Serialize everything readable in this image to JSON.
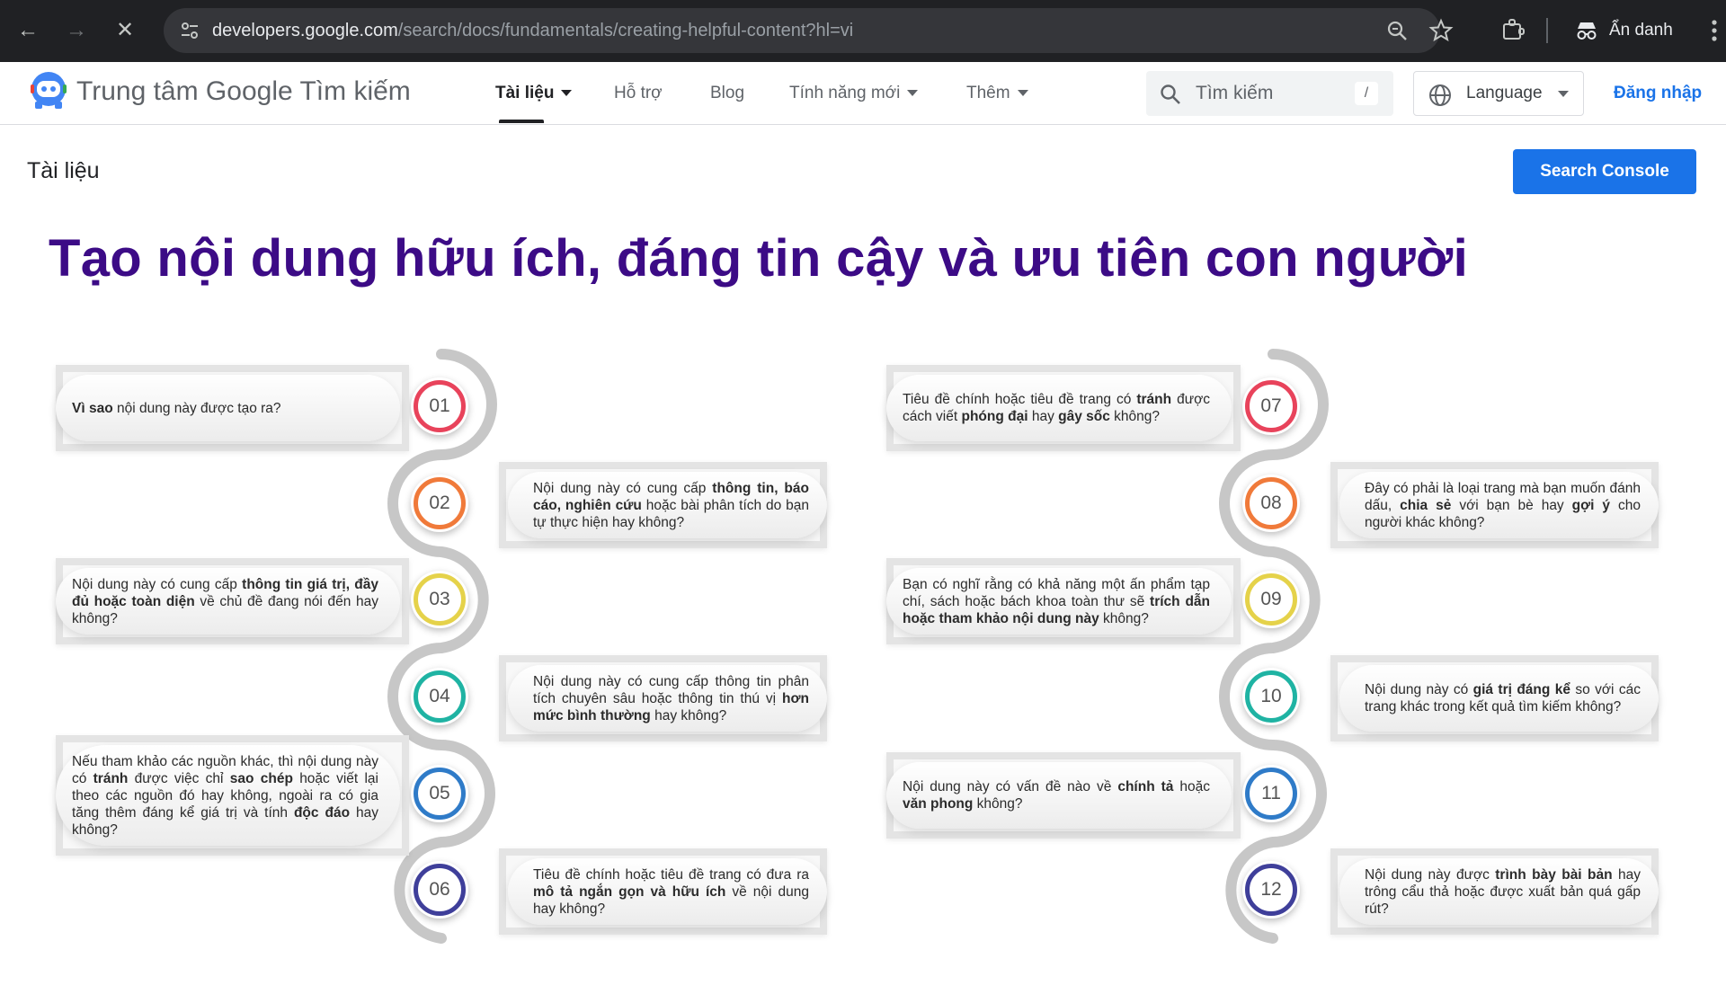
{
  "browser": {
    "url_host": "developers.google.com",
    "url_path": "/search/docs/fundamentals/creating-helpful-content?hl=vi",
    "incognito_label": "Ẩn danh"
  },
  "header": {
    "site_title": "Trung tâm Google Tìm kiếm",
    "nav": [
      {
        "label": "Tài liệu"
      },
      {
        "label": "Hỗ trợ"
      },
      {
        "label": "Blog"
      },
      {
        "label": "Tính năng mới"
      },
      {
        "label": "Thêm"
      }
    ],
    "search_placeholder": "Tìm kiếm",
    "search_shortcut": "/",
    "language_label": "Language",
    "signin_label": "Đăng nhập"
  },
  "subheader": {
    "breadcrumb": "Tài liệu",
    "search_console_label": "Search Console"
  },
  "page_title": "Tạo nội dung hữu ích, đáng tin cậy và ưu tiên con người",
  "infographic": {
    "items": [
      {
        "num": "01",
        "color": "#e8435b",
        "html": "<b>Vì sao</b> nội dung này được tạo ra?"
      },
      {
        "num": "02",
        "color": "#f07a3a",
        "html": "Nội dung này có cung cấp <b>thông tin, báo cáo, nghiên cứu</b> hoặc bài phân tích do bạn tự thực hiện hay không?"
      },
      {
        "num": "03",
        "color": "#e5d24a",
        "html": "Nội dung này có cung cấp <b>thông tin giá trị, đầy đủ hoặc toàn diện</b> về chủ đề đang nói đến hay không?"
      },
      {
        "num": "04",
        "color": "#1fb3a3",
        "html": "Nội dung này có cung cấp thông tin phân tích chuyên sâu hoặc thông tin thú vị <b>hơn mức bình thường</b> hay không?"
      },
      {
        "num": "05",
        "color": "#2f7bc8",
        "html": "Nếu tham khảo các nguồn khác, thì nội dung này có <b>tránh</b> được việc chỉ <b>sao chép</b> hoặc viết lại theo các nguồn đó hay không, ngoài ra có gia tăng thêm đáng kể giá trị và tính <b>độc đáo</b> hay không?"
      },
      {
        "num": "06",
        "color": "#3f3f9a",
        "html": "Tiêu đề chính hoặc tiêu đề trang có đưa ra <b>mô tả ngắn gọn và hữu ích</b> về nội dung hay không?"
      },
      {
        "num": "07",
        "color": "#e8435b",
        "html": "Tiêu đề chính hoặc tiêu đề trang có <b>tránh</b> được cách viết <b>phóng đại</b> hay <b>gây sốc</b> không?"
      },
      {
        "num": "08",
        "color": "#f07a3a",
        "html": "Đây có phải là loại trang mà bạn muốn đánh dấu, <b>chia sẻ</b> với bạn bè hay <b>gợi ý</b> cho người khác không?"
      },
      {
        "num": "09",
        "color": "#e5d24a",
        "html": "Bạn có nghĩ rằng có khả năng một ấn phẩm tạp chí, sách hoặc bách khoa toàn thư sẽ <b>trích dẫn hoặc tham khảo nội dung này</b> không?"
      },
      {
        "num": "10",
        "color": "#1fb3a3",
        "html": "Nội dung này có <b>giá trị đáng kể</b> so với các trang khác trong kết quả tìm kiếm không?"
      },
      {
        "num": "11",
        "color": "#2f7bc8",
        "html": "Nội dung này có vấn đề nào về <b>chính tả</b> hoặc <b>văn phong</b> không?"
      },
      {
        "num": "12",
        "color": "#3f3f9a",
        "html": "Nội dung này được <b>trình bày bài bản</b> hay trông cẩu thả hoặc được xuất bản quá gấp rút?"
      }
    ]
  },
  "colors": {
    "title": "#3c0b86",
    "primary_button": "#1a73e8",
    "link": "#1a73e8"
  }
}
